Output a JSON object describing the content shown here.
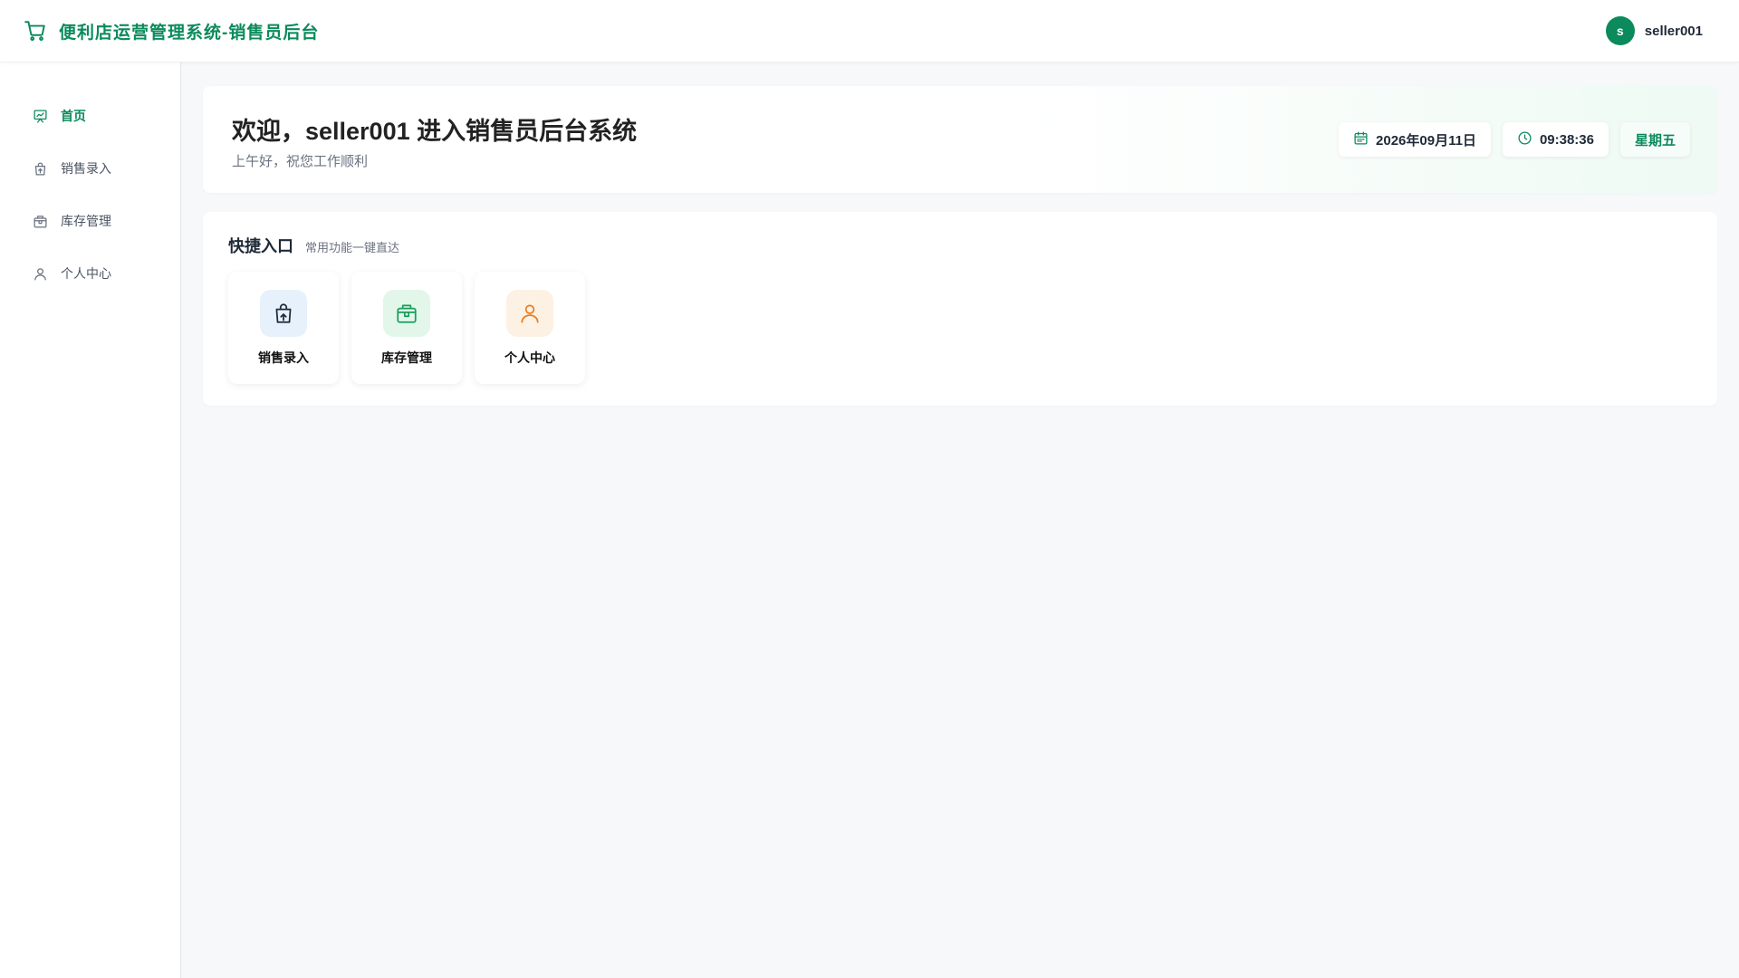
{
  "header": {
    "title": "便利店运营管理系统-销售员后台",
    "brand_icon": "shopping-cart-icon",
    "user": {
      "avatar_letter": "s",
      "name": "seller001"
    }
  },
  "sidebar": {
    "items": [
      {
        "label": "首页",
        "icon": "home-presentation-icon",
        "active": true
      },
      {
        "label": "销售录入",
        "icon": "shopping-bag-icon",
        "active": false
      },
      {
        "label": "库存管理",
        "icon": "package-icon",
        "active": false
      },
      {
        "label": "个人中心",
        "icon": "user-icon",
        "active": false
      }
    ]
  },
  "welcome": {
    "title": "欢迎，seller001 进入销售员后台系统",
    "subtitle": "上午好，祝您工作顺利",
    "date": "2026年09月11日",
    "time": "09:38:36",
    "weekday": "星期五"
  },
  "quick": {
    "title": "快捷入口",
    "subtitle": "常用功能一键直达",
    "cards": [
      {
        "label": "销售录入",
        "icon": "shopping-bag-icon",
        "bg": "#e6f1fb",
        "color": "#1f2937"
      },
      {
        "label": "库存管理",
        "icon": "package-icon",
        "bg": "#e3f6ea",
        "color": "#16a05a"
      },
      {
        "label": "个人中心",
        "icon": "user-icon",
        "bg": "#fdf1e4",
        "color": "#e67e22"
      }
    ]
  },
  "colors": {
    "accent": "#0b8a5c",
    "background": "#f7f8fa"
  }
}
